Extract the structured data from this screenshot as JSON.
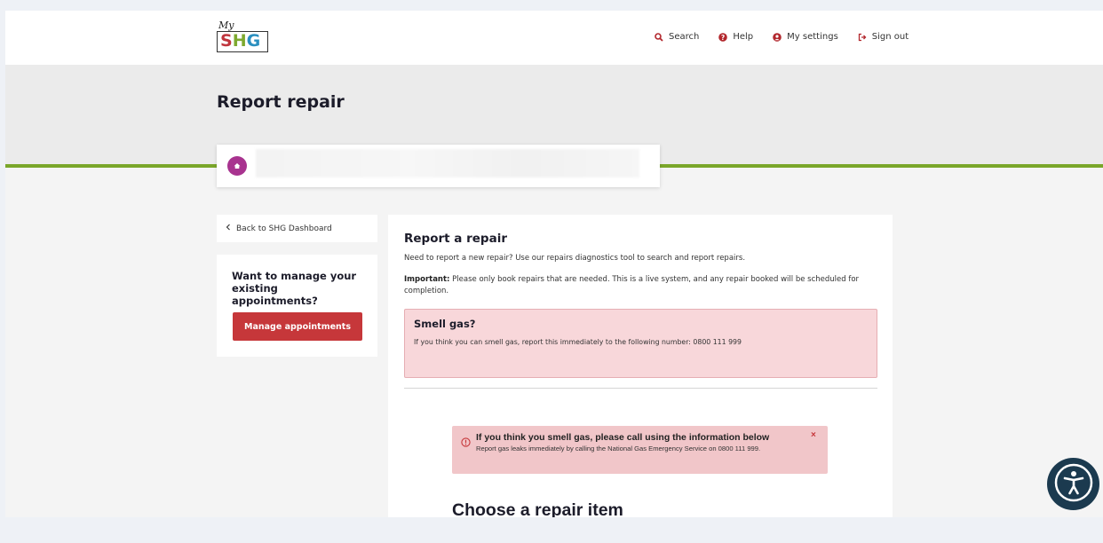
{
  "header": {
    "logo": {
      "my": "My",
      "s": "S",
      "h": "H",
      "g": "G"
    },
    "nav": [
      {
        "label": "Search",
        "icon": "search-icon"
      },
      {
        "label": "Help",
        "icon": "question-icon"
      },
      {
        "label": "My settings",
        "icon": "user-icon"
      },
      {
        "label": "Sign out",
        "icon": "sign-out-icon"
      }
    ]
  },
  "page": {
    "title": "Report repair"
  },
  "sidebar": {
    "back_link": "Back to SHG Dashboard",
    "appointments": {
      "title": "Want to manage your existing appointments?",
      "button": "Manage appointments"
    }
  },
  "main": {
    "heading": "Report a repair",
    "intro": "Need to report a new repair? Use our repairs diagnostics tool to search and report repairs.",
    "important_label": "Important:",
    "important_text": " Please only book repairs that are needed. This is a live system, and any repair booked will be scheduled for completion.",
    "gas_box": {
      "title": "Smell gas?",
      "text": "If you think you can smell gas, report this immediately to the following number: 0800 111 999"
    },
    "alert": {
      "title": "If you think you smell gas, please call using the information below",
      "text": "Report gas leaks immediately by calling the National Gas Emergency Service on 0800 111 999.",
      "close": "×"
    },
    "choose_heading": "Choose a repair item"
  },
  "colors": {
    "brand_red": "#c6373a",
    "brand_green": "#7aa62a",
    "address_icon": "#a8338f",
    "alert_bg": "#f1c6c9",
    "a11y_button": "#1b3a4f"
  }
}
